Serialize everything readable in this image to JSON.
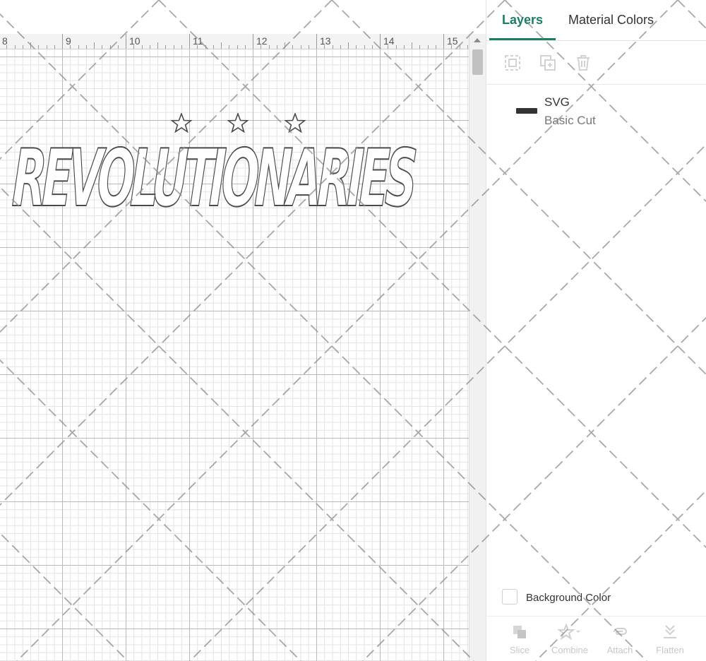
{
  "canvas": {
    "ruler_labels": [
      "8",
      "9",
      "10",
      "11",
      "12",
      "13",
      "14",
      "15"
    ],
    "design_text": "REVOLUTIONARIES",
    "star_count": 3,
    "stroke_color": "#4a4a4a"
  },
  "panel": {
    "tabs": [
      {
        "label": "Layers",
        "active": true
      },
      {
        "label": "Material Colors",
        "active": false
      }
    ],
    "accent_color": "#1a7f63",
    "layer_actions": [
      "group-icon",
      "duplicate-icon",
      "delete-icon"
    ],
    "layers": [
      {
        "name": "SVG",
        "type": "Basic Cut"
      }
    ],
    "background_color_label": "Background Color",
    "bottom_tools": [
      {
        "label": "Slice",
        "icon": "slice-icon"
      },
      {
        "label": "Combine",
        "icon": "combine-icon"
      },
      {
        "label": "Attach",
        "icon": "attach-icon"
      },
      {
        "label": "Flatten",
        "icon": "flatten-icon"
      }
    ]
  }
}
